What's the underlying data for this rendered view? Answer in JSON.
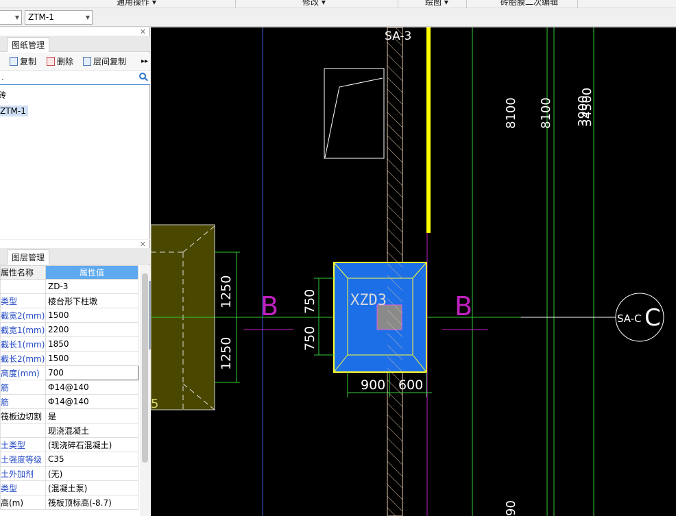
{
  "ribbon": {
    "groups": [
      {
        "label": "通用操作 ▾"
      },
      {
        "label": "修改 ▾"
      },
      {
        "label": "绘图 ▾"
      },
      {
        "label": "砖胎膜二次编辑"
      }
    ]
  },
  "toolbar": {
    "layer_combo": "",
    "component_combo": "ZTM-1"
  },
  "top_panel": {
    "tabs": [
      "",
      "图纸管理"
    ],
    "buttons": {
      "copy": "复制",
      "delete": "删除",
      "floor_copy": "层间复制"
    },
    "search_placeholder": ".",
    "tree": {
      "root": "砖",
      "item": "ZTM-1"
    }
  },
  "bottom_panel": {
    "tabs": [
      "",
      "图层管理"
    ],
    "header": {
      "name": "属性名称",
      "value": "属性值"
    },
    "rows": [
      {
        "name": "",
        "value": "ZD-3",
        "blue": false
      },
      {
        "name": "类型",
        "value": "棱台形下柱墩",
        "blue": true
      },
      {
        "name": "截宽2(mm)",
        "value": "1500",
        "blue": true
      },
      {
        "name": "截宽1(mm)",
        "value": "2200",
        "blue": true
      },
      {
        "name": "截长1(mm)",
        "value": "1850",
        "blue": true
      },
      {
        "name": "截长2(mm)",
        "value": "1500",
        "blue": true
      },
      {
        "name": "高度(mm)",
        "value": "700",
        "blue": true,
        "editing": true
      },
      {
        "name": "筋",
        "value": "Φ14@140",
        "blue": true
      },
      {
        "name": "筋",
        "value": "Φ14@140",
        "blue": true
      },
      {
        "name": "筏板边切割",
        "value": "是",
        "blue": false
      },
      {
        "name": "",
        "value": "现浇混凝土",
        "blue": false
      },
      {
        "name": "土类型",
        "value": "(现浇碎石混凝土)",
        "blue": true
      },
      {
        "name": "土强度等级",
        "value": "C35",
        "blue": true
      },
      {
        "name": "土外加剂",
        "value": "(无)",
        "blue": true
      },
      {
        "name": "类型",
        "value": "(混凝土泵)",
        "blue": true
      },
      {
        "name": "高(m)",
        "value": "筏板顶标高(-8.7)",
        "blue": false
      }
    ]
  },
  "canvas": {
    "labels": {
      "sa3": "SA-3",
      "xzd3": "XZD3",
      "dim_1250_top": "1250",
      "dim_1250_bot": "1250",
      "dim_750_top": "750",
      "dim_750_bot": "750",
      "dim_900": "900",
      "dim_600": "600",
      "dim_8100_a": "8100",
      "dim_8100_b": "8100",
      "dim_right_a": "3900",
      "dim_right_b": "34500",
      "section_b_left": "B",
      "section_b_right": "B",
      "axis_bubble_outer": "C",
      "axis_bubble_inner": "SA-C",
      "dim_bottom": "90",
      "left_partial": "5"
    }
  }
}
